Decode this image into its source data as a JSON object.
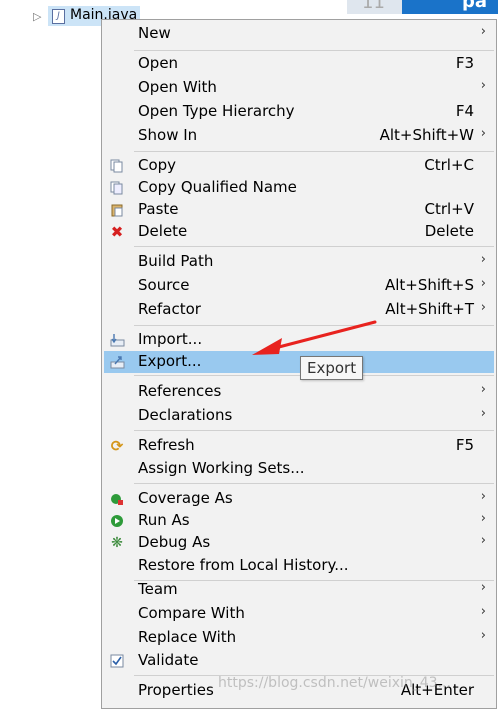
{
  "tree": {
    "file_label": "Main.java",
    "file_icon": "java-file-icon"
  },
  "editor": {
    "line_number": "11",
    "tab_text": "pa"
  },
  "menu": {
    "items": [
      {
        "label": "New",
        "shortcut": "",
        "submenu": true,
        "icon": ""
      },
      {
        "label": "Open",
        "shortcut": "F3",
        "submenu": false,
        "icon": ""
      },
      {
        "label": "Open With",
        "shortcut": "",
        "submenu": true,
        "icon": ""
      },
      {
        "label": "Open Type Hierarchy",
        "shortcut": "F4",
        "submenu": false,
        "icon": ""
      },
      {
        "label": "Show In",
        "shortcut": "Alt+Shift+W",
        "submenu": true,
        "icon": ""
      },
      {
        "label": "Copy",
        "shortcut": "Ctrl+C",
        "submenu": false,
        "icon": "copy-icon"
      },
      {
        "label": "Copy Qualified Name",
        "shortcut": "",
        "submenu": false,
        "icon": "copy-qualified-name-icon"
      },
      {
        "label": "Paste",
        "shortcut": "Ctrl+V",
        "submenu": false,
        "icon": "paste-icon"
      },
      {
        "label": "Delete",
        "shortcut": "Delete",
        "submenu": false,
        "icon": "delete-icon"
      },
      {
        "label": "Build Path",
        "shortcut": "",
        "submenu": true,
        "icon": ""
      },
      {
        "label": "Source",
        "shortcut": "Alt+Shift+S",
        "submenu": true,
        "icon": ""
      },
      {
        "label": "Refactor",
        "shortcut": "Alt+Shift+T",
        "submenu": true,
        "icon": ""
      },
      {
        "label": "Import...",
        "shortcut": "",
        "submenu": false,
        "icon": "import-icon"
      },
      {
        "label": "Export...",
        "shortcut": "",
        "submenu": false,
        "icon": "export-icon"
      },
      {
        "label": "References",
        "shortcut": "",
        "submenu": true,
        "icon": ""
      },
      {
        "label": "Declarations",
        "shortcut": "",
        "submenu": true,
        "icon": ""
      },
      {
        "label": "Refresh",
        "shortcut": "F5",
        "submenu": false,
        "icon": "refresh-icon"
      },
      {
        "label": "Assign Working Sets...",
        "shortcut": "",
        "submenu": false,
        "icon": ""
      },
      {
        "label": "Coverage As",
        "shortcut": "",
        "submenu": true,
        "icon": "coverage-icon"
      },
      {
        "label": "Run As",
        "shortcut": "",
        "submenu": true,
        "icon": "run-icon"
      },
      {
        "label": "Debug As",
        "shortcut": "",
        "submenu": true,
        "icon": "debug-icon"
      },
      {
        "label": "Restore from Local History...",
        "shortcut": "",
        "submenu": false,
        "icon": ""
      },
      {
        "label": "Team",
        "shortcut": "",
        "submenu": true,
        "icon": ""
      },
      {
        "label": "Compare With",
        "shortcut": "",
        "submenu": true,
        "icon": ""
      },
      {
        "label": "Replace With",
        "shortcut": "",
        "submenu": true,
        "icon": ""
      },
      {
        "label": "Validate",
        "shortcut": "",
        "submenu": false,
        "icon": "validate-check-icon"
      },
      {
        "label": "Properties",
        "shortcut": "Alt+Enter",
        "submenu": false,
        "icon": ""
      }
    ],
    "highlighted": "Export..."
  },
  "tooltip": {
    "text": "Export"
  },
  "watermark": {
    "text": "https://blog.csdn.net/weixin_43..."
  },
  "colors": {
    "highlight": "#99c9ef",
    "annotation_arrow": "#e8231f",
    "menu_bg": "#f2f2f2"
  }
}
